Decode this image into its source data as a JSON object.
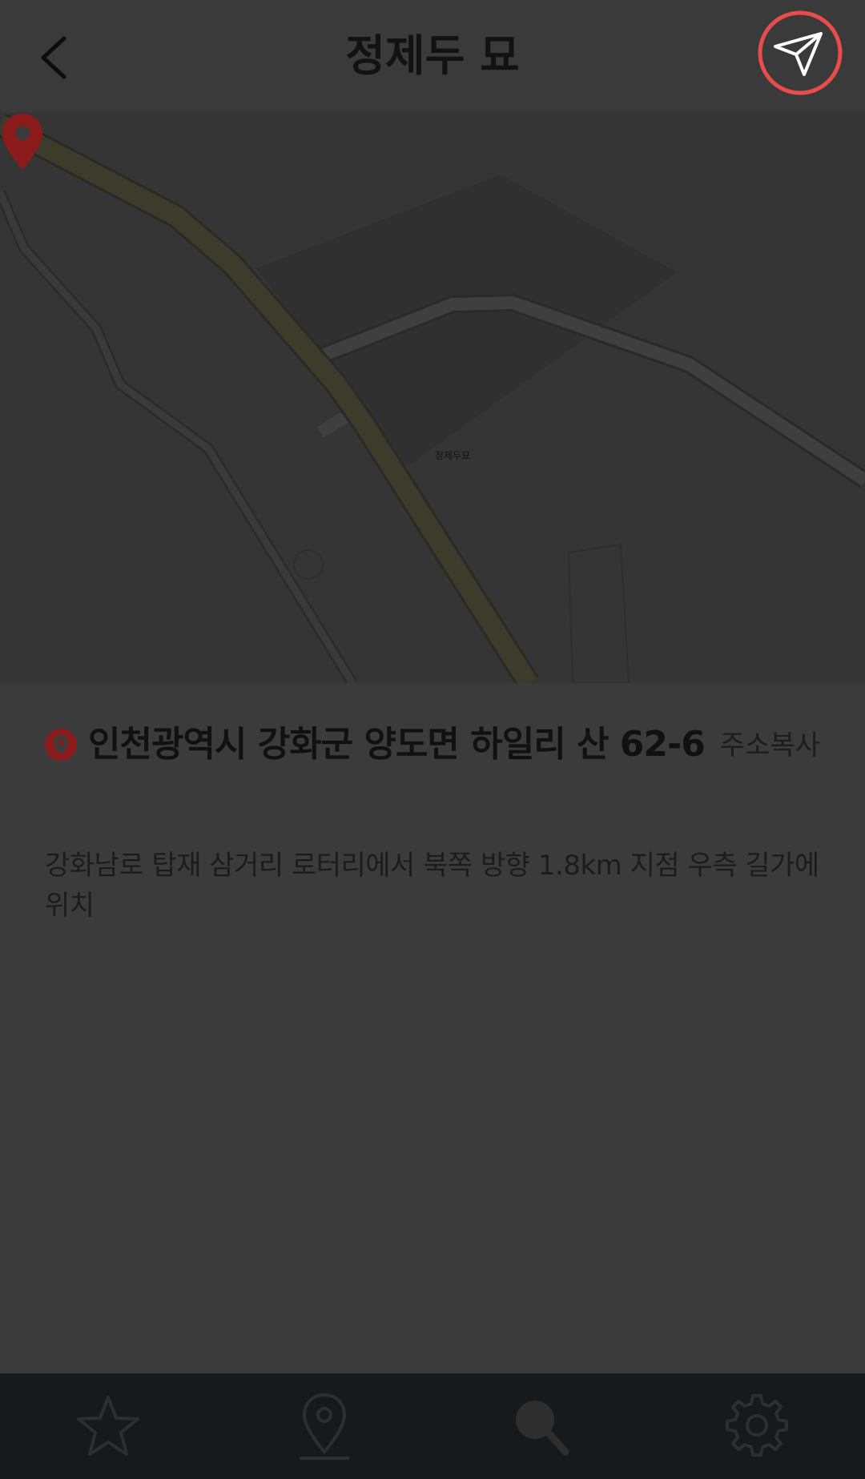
{
  "header": {
    "title": "정제두 묘",
    "back_icon": "chevron-left-icon",
    "navigate_icon": "navigation-arrow-icon"
  },
  "map": {
    "marker_label": "정제두묘",
    "marker_color": "#8b1a1a"
  },
  "place": {
    "address": "인천광역시 강화군 양도면 하일리 산 62-6",
    "copy_label": "주소복사",
    "description": "강화남로 탑재 삼거리 로터리에서 북쪽 방향 1.8km 지점 우측 길가에 위치"
  },
  "bottom_nav": {
    "items": [
      {
        "icon": "star-icon"
      },
      {
        "icon": "map-pin-icon"
      },
      {
        "icon": "search-icon"
      },
      {
        "icon": "gear-icon"
      }
    ]
  },
  "colors": {
    "accent": "#e84c4c",
    "nav_background": "#18191b"
  }
}
